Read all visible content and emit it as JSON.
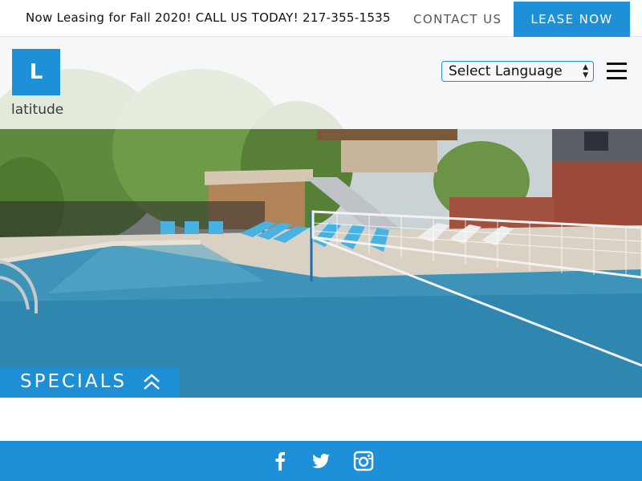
{
  "topbar": {
    "announcement": "Now Leasing for Fall 2020! CALL US TODAY! 217-355-1535",
    "contact_label": "CONTACT US",
    "lease_label": "LEASE NOW"
  },
  "header": {
    "logo_letter": "L",
    "logo_text": "latitude",
    "language_select": "Select Language",
    "menu_icon": "hamburger-icon"
  },
  "hero": {
    "image": "pool-photo"
  },
  "specials": {
    "label": "SPECIALS",
    "icon": "double-chevron-up-icon"
  },
  "footer": {
    "social": [
      "facebook-icon",
      "twitter-icon",
      "instagram-icon"
    ]
  },
  "colors": {
    "accent": "#1e90d8",
    "text": "#111111",
    "muted": "#555555"
  }
}
